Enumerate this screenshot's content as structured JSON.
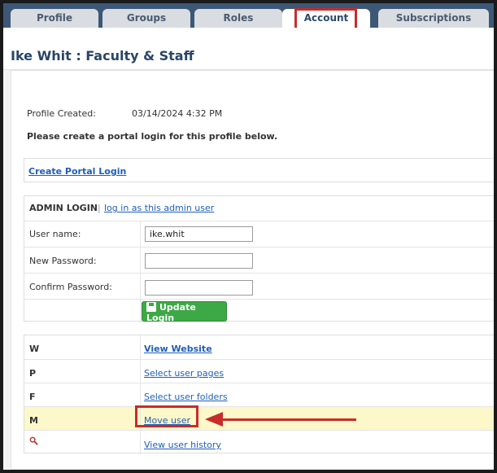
{
  "tabs": [
    "Profile",
    "Groups",
    "Roles",
    "Account",
    "Subscriptions"
  ],
  "active_tab": "Account",
  "page_title": "Ike Whit : Faculty & Staff",
  "profile": {
    "created_label": "Profile Created:",
    "created_value": "03/14/2024 4:32 PM",
    "message": "Please create a portal login for this profile below."
  },
  "create_login_link": "Create Portal Login",
  "admin_login": {
    "heading": "ADMIN LOGIN",
    "separator": "|",
    "login_as_link": "log in as this admin user",
    "username_label": "User name:",
    "username_value": "ike.whit",
    "new_password_label": "New Password:",
    "confirm_password_label": "Confirm Password:",
    "update_button": "Update Login"
  },
  "actions": [
    {
      "key": "W",
      "label": "View Website"
    },
    {
      "key": "P",
      "label": "Select user pages"
    },
    {
      "key": "F",
      "label": "Select user folders"
    },
    {
      "key": "M",
      "label": "Move user"
    },
    {
      "key": "",
      "label": "View user history",
      "icon": "magnifier-icon"
    }
  ],
  "colors": {
    "tabbar": "#3d5877",
    "highlight": "#c62d2d",
    "button_green": "#3da846",
    "row_highlight": "#fdf8c9",
    "link": "#1f5fb8"
  }
}
